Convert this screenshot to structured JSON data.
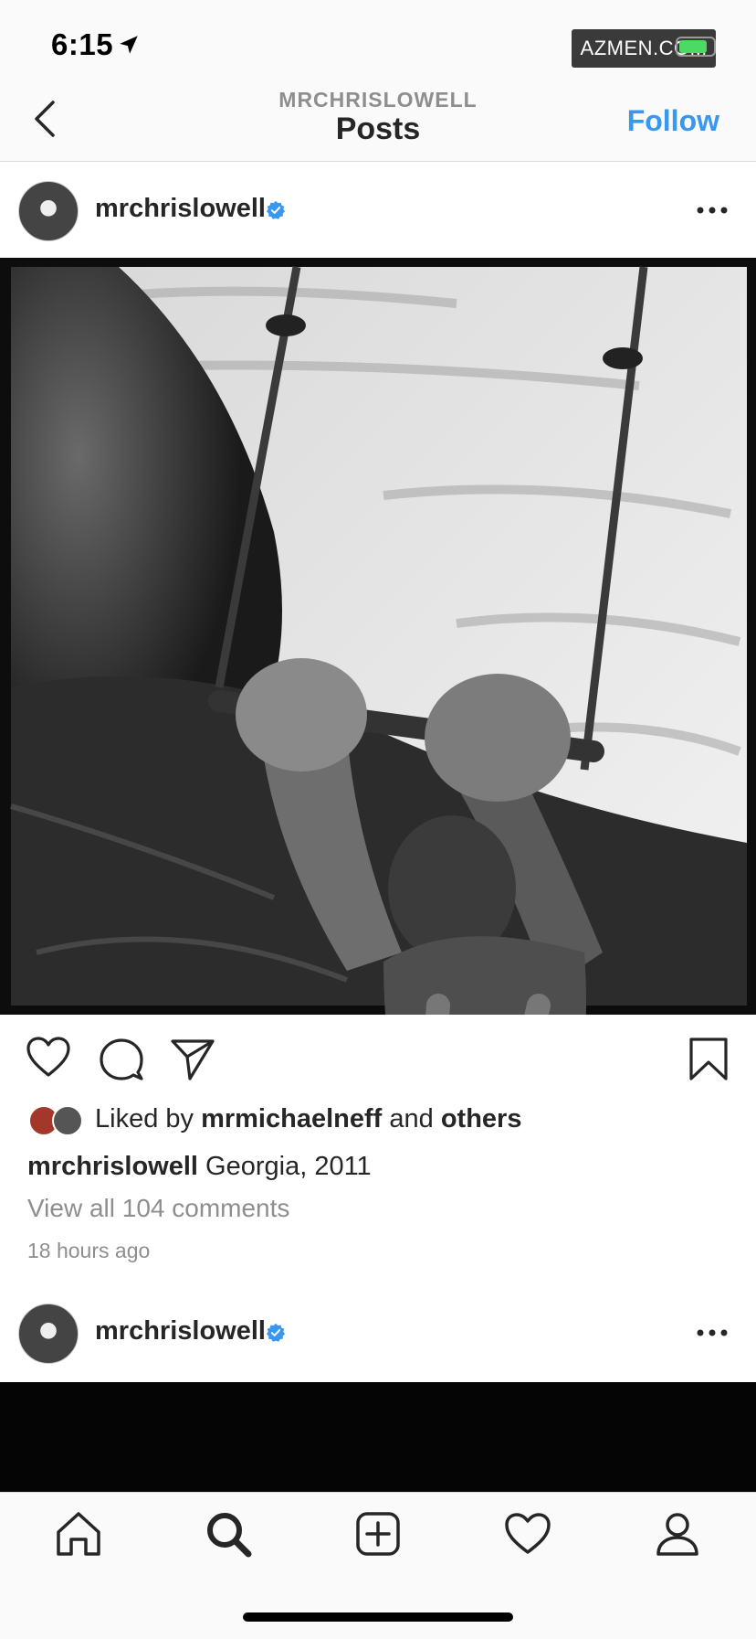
{
  "status_bar": {
    "time": "6:15"
  },
  "watermark": "AZMEN.COM",
  "nav": {
    "subtitle": "MRCHRISLOWELL",
    "title": "Posts",
    "follow_label": "Follow"
  },
  "post1": {
    "username": "mrchrislowell",
    "likes": {
      "prefix": "Liked by",
      "user": "mrmichaelneff",
      "and": "and",
      "others": "others"
    },
    "caption": {
      "username": "mrchrislowell",
      "text": "Georgia, 2011"
    },
    "comments_link": "View all 104 comments",
    "timestamp": "18 hours ago"
  },
  "post2": {
    "username": "mrchrislowell"
  },
  "icons": {
    "like": "heart-icon",
    "comment": "comment-icon",
    "share": "paper-plane-icon",
    "save": "bookmark-icon",
    "home": "home-icon",
    "search": "search-icon",
    "new_post": "plus-square-icon",
    "activity": "heart-icon",
    "profile": "profile-icon"
  },
  "colors": {
    "accent": "#3897f0",
    "text": "#262626",
    "muted": "#8e8e8e",
    "verified": "#3897f0"
  }
}
